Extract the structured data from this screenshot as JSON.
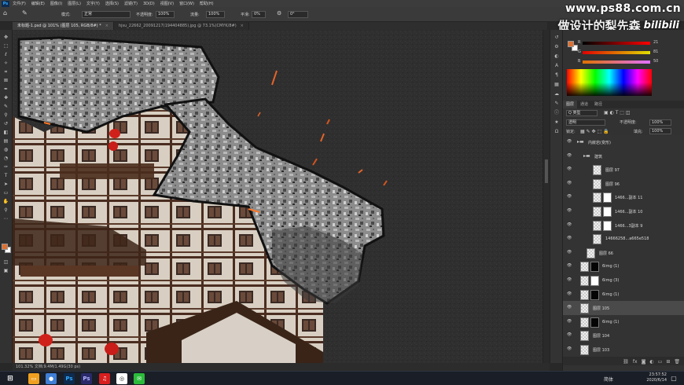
{
  "menubar": {
    "items": [
      "文件(F)",
      "编辑(E)",
      "图像(I)",
      "图层(L)",
      "文字(Y)",
      "选择(S)",
      "滤镜(T)",
      "3D(D)",
      "视图(V)",
      "窗口(W)",
      "帮助(H)"
    ]
  },
  "app": {
    "logo": "Ps"
  },
  "options": {
    "mode_label": "模式:",
    "mode_value": "正常",
    "opacity_label": "不透明度:",
    "opacity_value": "100%",
    "flow_label": "流量:",
    "flow_value": "100%",
    "smooth_label": "平滑:",
    "smooth_value": "0%",
    "angle_value": "0°"
  },
  "watermark": {
    "site": "www.ps88.com.cn",
    "name": "做设计的梨先森",
    "brand": "bilibili"
  },
  "tabs": [
    {
      "label": "未标题-1.psd @ 101% (图层 105, RGB/8#) *",
      "active": true
    },
    {
      "label": "hjsu_22662_20091217(194404885).jpg @ 73.1%(CMYK/8#)",
      "active": false
    }
  ],
  "doc_status": "101.32%   文档:9.4M/1.49G(30 ps)",
  "color": {
    "fg": "#e07030",
    "bg": "#ffffff",
    "r_label": "R",
    "g_label": "G",
    "b_label": "B",
    "r": "21",
    "g": "81",
    "b": "50"
  },
  "layers": {
    "tabs": [
      "图层",
      "通道",
      "路径"
    ],
    "filter_label": "Q 类型",
    "blend_mode": "透明",
    "opacity_label": "不透明度:",
    "opacity": "100%",
    "lock_label": "锁定:",
    "fill_label": "填充:",
    "fill": "100%",
    "rows": [
      {
        "name": "内嵌岩(变形)",
        "kind": "group",
        "indent": 0
      },
      {
        "name": "建筑",
        "kind": "group",
        "indent": 1
      },
      {
        "name": "图层 97",
        "kind": "layer",
        "indent": 2
      },
      {
        "name": "图层 96",
        "kind": "layer",
        "indent": 2
      },
      {
        "name": "1466...副本 11",
        "kind": "masked",
        "indent": 2
      },
      {
        "name": "1466...副本 10",
        "kind": "masked",
        "indent": 2
      },
      {
        "name": "1466...3副本 9",
        "kind": "masked",
        "indent": 2
      },
      {
        "name": "14666258...a665e518",
        "kind": "layer",
        "indent": 2
      },
      {
        "name": "图层 66",
        "kind": "layer",
        "indent": 1
      },
      {
        "name": "6img (1)",
        "kind": "dark",
        "indent": 0
      },
      {
        "name": "6img (3)",
        "kind": "dark",
        "indent": 0
      },
      {
        "name": "6img (1)",
        "kind": "dark",
        "indent": 0
      },
      {
        "name": "图层 105",
        "kind": "layer",
        "indent": 0,
        "selected": true
      },
      {
        "name": "6img (1)",
        "kind": "dark",
        "indent": 0
      },
      {
        "name": "图层 104",
        "kind": "layer",
        "indent": 0
      },
      {
        "name": "图层 103",
        "kind": "layer",
        "indent": 0
      }
    ]
  },
  "taskbar": {
    "time": "23:57:52",
    "date": "2020/6/14",
    "ime": "简体"
  }
}
